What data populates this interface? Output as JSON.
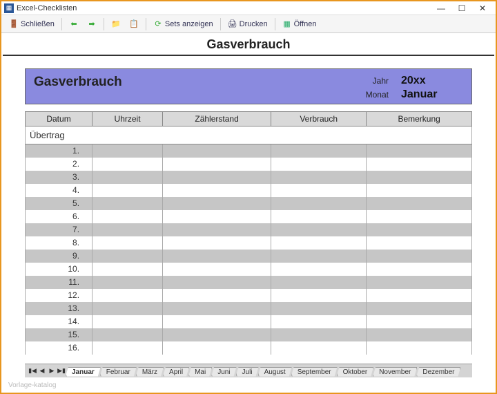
{
  "window": {
    "title": "Excel-Checklisten"
  },
  "toolbar": {
    "close": "Schließen",
    "sets": "Sets anzeigen",
    "print": "Drucken",
    "open": "Öffnen"
  },
  "page": {
    "title": "Gasverbrauch"
  },
  "header": {
    "title": "Gasverbrauch",
    "year_label": "Jahr",
    "year_value": "20xx",
    "month_label": "Monat",
    "month_value": "Januar"
  },
  "columns": [
    "Datum",
    "Uhrzeit",
    "Zählerstand",
    "Verbrauch",
    "Bemerkung"
  ],
  "ubertrag": "Übertrag",
  "rows": [
    "1.",
    "2.",
    "3.",
    "4.",
    "5.",
    "6.",
    "7.",
    "8.",
    "9.",
    "10.",
    "11.",
    "12.",
    "13.",
    "14.",
    "15.",
    "16."
  ],
  "tabs": [
    "Januar",
    "Februar",
    "März",
    "April",
    "Mai",
    "Juni",
    "Juli",
    "August",
    "September",
    "Oktober",
    "November",
    "Dezember"
  ],
  "active_tab": "Januar",
  "footer": "Vorlage-katalog"
}
